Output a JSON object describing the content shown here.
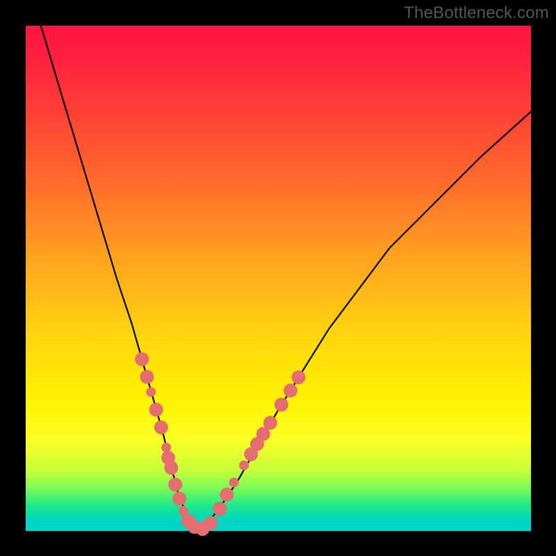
{
  "watermark": "TheBottleneck.com",
  "chart_data": {
    "type": "line",
    "title": "",
    "xlabel": "",
    "ylabel": "",
    "xlim": [
      0,
      100
    ],
    "ylim": [
      0,
      100
    ],
    "grid": false,
    "series": [
      {
        "name": "bottleneck-curve",
        "x": [
          3,
          6,
          9,
          12,
          15,
          18,
          21,
          23,
          25,
          27,
          28.5,
          30,
          31.5,
          33,
          34.5,
          38,
          42,
          46,
          50,
          55,
          60,
          66,
          72,
          80,
          90,
          100
        ],
        "y": [
          100,
          90,
          80,
          70,
          60,
          50,
          41,
          34,
          27,
          20,
          14,
          8,
          4,
          1,
          0,
          4,
          10,
          17,
          24,
          32,
          40,
          48,
          56,
          64,
          74,
          83
        ]
      }
    ],
    "markers": {
      "name": "highlighted-points",
      "color": "#e46e6e",
      "radius_large": 10,
      "radius_small": 7,
      "points": [
        {
          "x": 23.0,
          "y": 34.0,
          "r": "large"
        },
        {
          "x": 24.0,
          "y": 30.5,
          "r": "large"
        },
        {
          "x": 24.8,
          "y": 27.5,
          "r": "small"
        },
        {
          "x": 25.8,
          "y": 24.0,
          "r": "large"
        },
        {
          "x": 26.8,
          "y": 20.5,
          "r": "large"
        },
        {
          "x": 27.8,
          "y": 16.5,
          "r": "small"
        },
        {
          "x": 28.2,
          "y": 14.5,
          "r": "large"
        },
        {
          "x": 28.8,
          "y": 12.5,
          "r": "large"
        },
        {
          "x": 29.6,
          "y": 9.2,
          "r": "large"
        },
        {
          "x": 30.4,
          "y": 6.4,
          "r": "large"
        },
        {
          "x": 31.2,
          "y": 4.0,
          "r": "small"
        },
        {
          "x": 32.2,
          "y": 2.0,
          "r": "large"
        },
        {
          "x": 33.4,
          "y": 0.8,
          "r": "large"
        },
        {
          "x": 35.0,
          "y": 0.4,
          "r": "large"
        },
        {
          "x": 36.6,
          "y": 1.6,
          "r": "large"
        },
        {
          "x": 38.4,
          "y": 4.4,
          "r": "large"
        },
        {
          "x": 39.8,
          "y": 7.2,
          "r": "large"
        },
        {
          "x": 41.2,
          "y": 9.6,
          "r": "small"
        },
        {
          "x": 43.2,
          "y": 13.0,
          "r": "small"
        },
        {
          "x": 44.6,
          "y": 15.2,
          "r": "large"
        },
        {
          "x": 45.8,
          "y": 17.2,
          "r": "large"
        },
        {
          "x": 47.0,
          "y": 19.2,
          "r": "large"
        },
        {
          "x": 48.4,
          "y": 21.4,
          "r": "large"
        },
        {
          "x": 50.6,
          "y": 25.0,
          "r": "large"
        },
        {
          "x": 52.4,
          "y": 27.8,
          "r": "large"
        },
        {
          "x": 54.0,
          "y": 30.4,
          "r": "large"
        }
      ]
    },
    "gradient_stops": [
      {
        "pos": 0.0,
        "color": "#ff153f"
      },
      {
        "pos": 0.18,
        "color": "#ff4336"
      },
      {
        "pos": 0.46,
        "color": "#ffa31f"
      },
      {
        "pos": 0.74,
        "color": "#fff200"
      },
      {
        "pos": 0.92,
        "color": "#6ff95c"
      },
      {
        "pos": 1.0,
        "color": "#00d4c4"
      }
    ]
  }
}
